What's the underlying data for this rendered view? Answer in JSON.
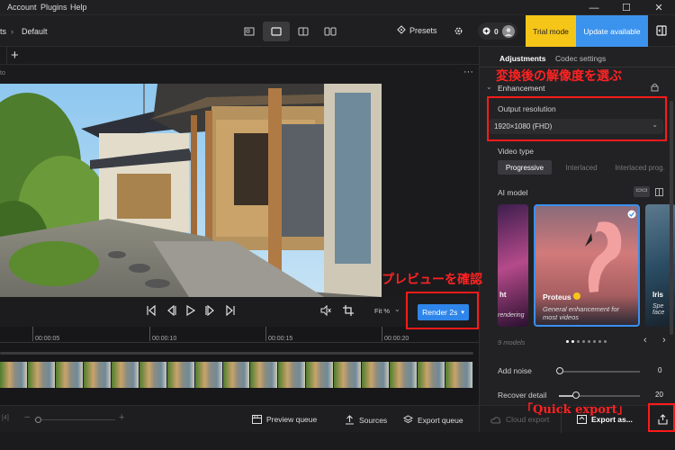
{
  "menu": {
    "items": [
      "Account",
      "Plugins",
      "Help"
    ]
  },
  "toolbar": {
    "breadcrumb_prefix": "ts",
    "breadcrumb_current": "Default",
    "presets_label": "Presets",
    "credits": "0",
    "trial_label": "Trial mode",
    "update_label": "Update available"
  },
  "preview": {
    "strip_label": "to",
    "render_label": "Render 2s",
    "zoom_label": "Fit %"
  },
  "timeline": {
    "ticks": [
      "00:00:05",
      "00:00:10",
      "00:00:15",
      "00:00:20"
    ],
    "frames": 17
  },
  "bottombar": {
    "preview_queue": "Preview queue",
    "sources": "Sources",
    "export_queue": "Export queue",
    "zoom_marker": "[4]"
  },
  "panel": {
    "tab_adjustments": "Adjustments",
    "tab_codec": "Codec settings",
    "enhancement_label": "Enhancement",
    "output_resolution_label": "Output resolution",
    "output_resolution_value": "1920×1080 (FHD)",
    "video_type_label": "Video type",
    "video_types": [
      "Progressive",
      "Interlaced",
      "Interlaced prog."
    ],
    "ai_model_label": "AI model",
    "models": [
      {
        "name": "ht",
        "desc": "rendering"
      },
      {
        "name": "Proteus",
        "desc": "General enhancement for most videos"
      },
      {
        "name": "Iris",
        "desc": "Spe face"
      }
    ],
    "models_count": "9 models",
    "add_noise_label": "Add noise",
    "add_noise_value": "0",
    "recover_detail_label": "Recover detail",
    "recover_detail_value": "20",
    "cloud_export": "Cloud export",
    "export_as": "Export as..."
  },
  "annotations": {
    "resolution": "変換後の解像度を選ぶ",
    "preview": "プレビューを確認",
    "quick_export": "「Quick export」"
  },
  "colors": {
    "accent_blue": "#2f86ea",
    "trial_yellow": "#f5c518",
    "annotation_red": "#ff1a1a"
  }
}
